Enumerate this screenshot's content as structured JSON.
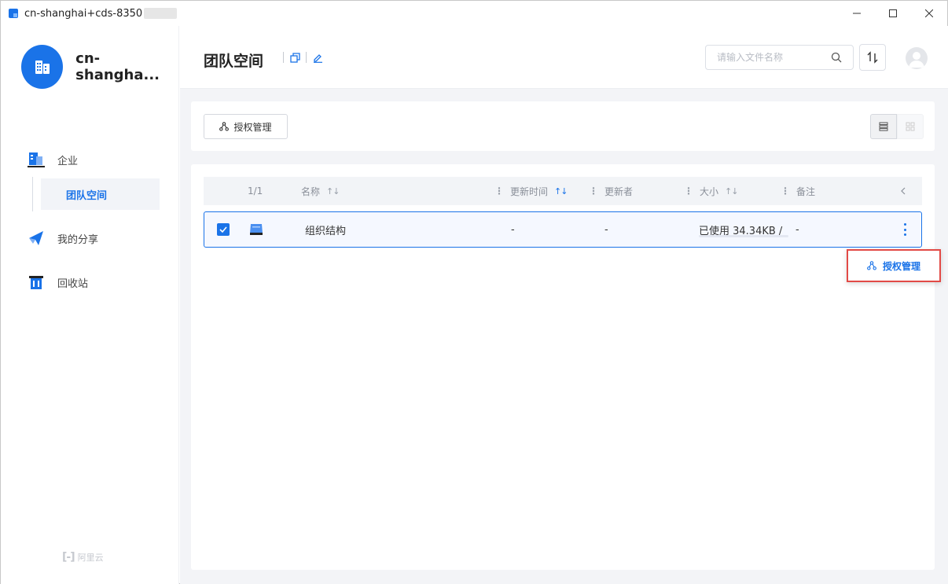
{
  "window": {
    "title": "cn-shanghai+cds-8350",
    "controls": [
      "minimize",
      "maximize",
      "close"
    ]
  },
  "sidebar": {
    "brand_name": "cn-shangha...",
    "nav": [
      {
        "label": "企业",
        "icon": "building-icon"
      },
      {
        "label": "团队空间",
        "icon": null,
        "active": true
      },
      {
        "label": "我的分享",
        "icon": "share-plane-icon"
      },
      {
        "label": "回收站",
        "icon": "trash-icon"
      }
    ],
    "footer_logo": "阿里云"
  },
  "header": {
    "page_title": "团队空间",
    "search_placeholder": "请输入文件名称"
  },
  "toolbar": {
    "auth_button_label": "授权管理"
  },
  "table": {
    "columns": {
      "count": "1/1",
      "name": "名称",
      "updated_time": "更新时间",
      "updater": "更新者",
      "size": "大小",
      "note": "备注"
    },
    "rows": [
      {
        "name": "组织结构",
        "updated_time": "-",
        "updater": "-",
        "size": "已使用 34.34KB /",
        "note": "-",
        "selected": true
      }
    ]
  },
  "context_menu": {
    "items": [
      {
        "label": "授权管理",
        "icon": "share-network-icon"
      }
    ]
  },
  "colors": {
    "accent": "#1a73e8",
    "highlight_border": "#e24a46",
    "background": "#f3f4f7"
  }
}
